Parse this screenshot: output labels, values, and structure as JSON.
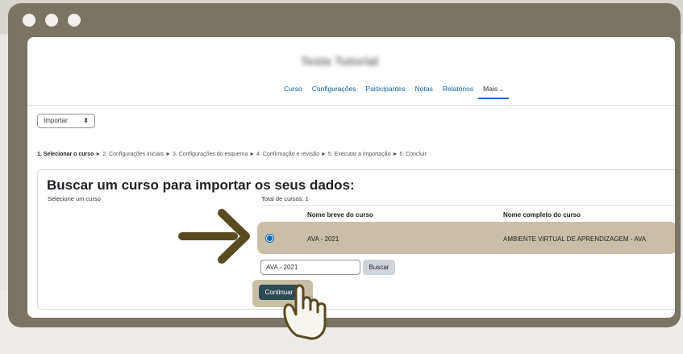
{
  "course": {
    "title": "Teste Tutorial"
  },
  "nav": {
    "items": [
      "Curso",
      "Configurações",
      "Participantes",
      "Notas",
      "Relatórios"
    ],
    "more_label": "Mais",
    "active": "Mais"
  },
  "select": {
    "value": "Importar"
  },
  "steps": {
    "current": "1. Selecionar o curso",
    "rest": "► 2. Configurações iniciais ► 3. Configurações do esquema ► 4. Confirmação e revisão ► 5. Executar a importação ► 6. Concluir"
  },
  "panel": {
    "heading": "Buscar um curso para importar os seus dados:",
    "select_label": "Selecione um curso",
    "total": "Total de cursos: 1",
    "columns": [
      "Nome breve do curso",
      "Nome completo do curso"
    ],
    "rows": [
      {
        "short": "AVA - 2021",
        "full": "AMBIENTE VIRTUAL DE APRENDIZAGEM - AVA",
        "selected": true
      }
    ],
    "search_value": "AVA - 2021",
    "search_button": "Buscar",
    "continue_button": "Continuar"
  },
  "colors": {
    "frame": "#7a7462",
    "highlight": "#c8bfa6",
    "arrow": "#5a4a1f",
    "link": "#0f5f9e",
    "primary_button": "#2a4a55"
  },
  "icons": [
    "arrow-right-icon",
    "hand-pointer-icon",
    "select-arrows-icon",
    "caret-down-icon"
  ]
}
